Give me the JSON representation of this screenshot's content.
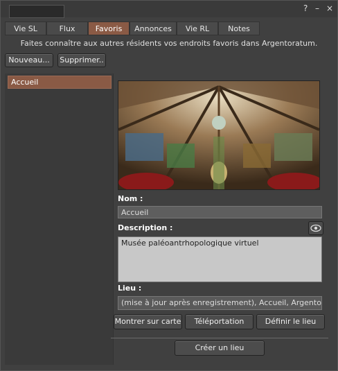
{
  "window": {
    "controls": [
      "?",
      "–",
      "×"
    ]
  },
  "tabs": [
    {
      "label": "Vie SL"
    },
    {
      "label": "Flux"
    },
    {
      "label": "Favoris",
      "active": true
    },
    {
      "label": "Annonces"
    },
    {
      "label": "Vie RL"
    },
    {
      "label": "Notes"
    }
  ],
  "info_text": "Faites connaître aux autres résidents vos endroits favoris dans Argentoratum.",
  "toolbar": {
    "new_label": "Nouveau...",
    "delete_label": "Supprimer.."
  },
  "picks": [
    {
      "label": "Accueil"
    }
  ],
  "detail": {
    "name_label": "Nom :",
    "name_value": "Accueil",
    "description_label": "Description :",
    "description_value": "Musée paléoantrhopologique virtuel",
    "location_label": "Lieu :",
    "location_value": "(mise à jour après enregistrement), Accueil, Argentora"
  },
  "actions": {
    "show_map": "Montrer sur carte",
    "teleport": "Téléportation",
    "set_location": "Définir le lieu",
    "create_place": "Créer un lieu"
  },
  "colors": {
    "accent": "#8a5a45",
    "panel": "#404040",
    "field": "#c8c8c8"
  }
}
